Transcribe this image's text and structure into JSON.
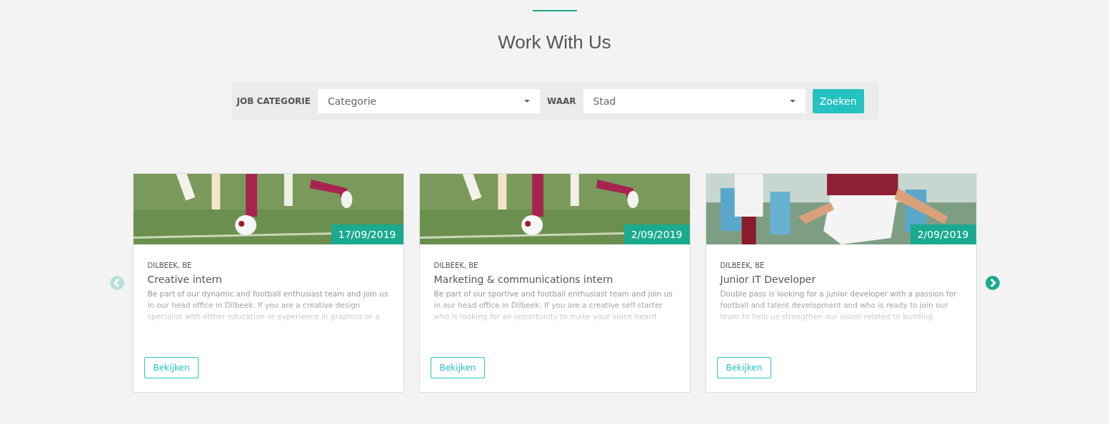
{
  "heading": "Work With Us",
  "search": {
    "category_label": "JOB CATEGORIE",
    "category_placeholder": "Categorie",
    "location_label": "WAAR",
    "location_placeholder": "Stad",
    "button": "Zoeken"
  },
  "carousel": {
    "prev": {
      "disabled": true
    },
    "next": {
      "disabled": false
    }
  },
  "jobs": [
    {
      "date": "17/09/2019",
      "location": "DILBEEK, BE",
      "title": "Creative intern",
      "description": "Be part of our dynamic and football enthusiast team and join us in our head office in Dilbeek. If you are a creative design specialist with either education or experience in graphics or a",
      "button": "Bekijken"
    },
    {
      "date": "2/09/2019",
      "location": "DILBEEK, BE",
      "title": "Marketing & communications intern",
      "description": "Be part of our sportive and football enthusiast team and join us in our head office in Dilbeek. If you are a creative self-starter who is looking for an opportunity to make your voice heard.",
      "button": "Bekijken"
    },
    {
      "date": "2/09/2019",
      "location": "DILBEEK, BE",
      "title": "Junior IT Developer",
      "description": "Double pass is looking for a junior developer with a passion for football and talent development and who is ready to join our team to help us strengthen our vision related to building",
      "button": "Bekijken"
    }
  ]
}
